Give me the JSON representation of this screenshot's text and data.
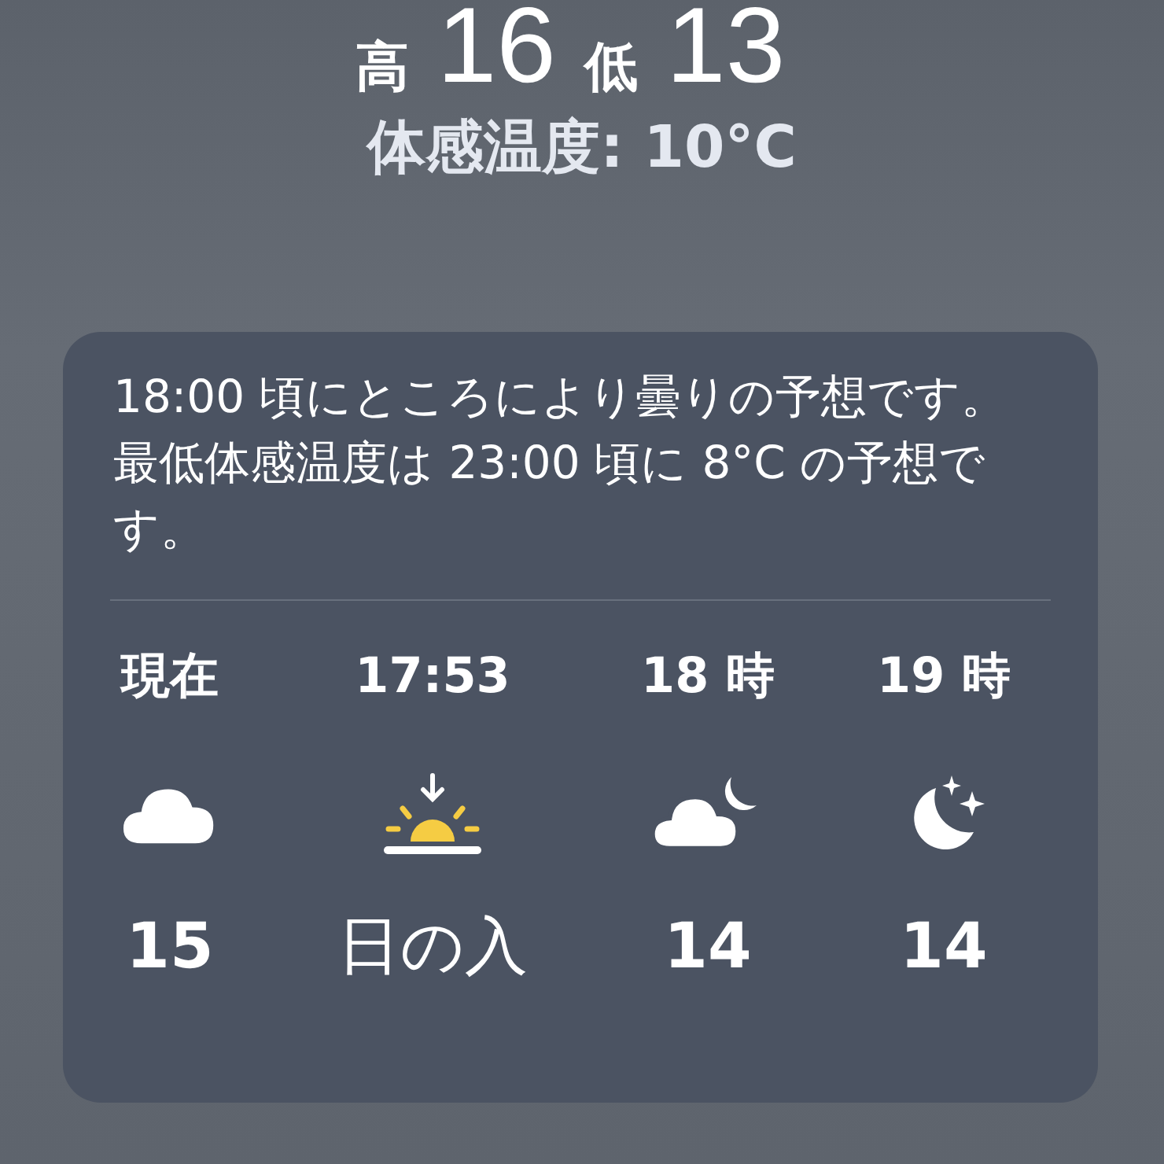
{
  "high": {
    "label": "高",
    "value": "16"
  },
  "low": {
    "label": "低",
    "value": "13"
  },
  "feels_like": "体感温度: 10°C",
  "summary": "18:00 頃にところにより曇りの予想です。最低体感温度は 23:00 頃に 8°C の予想です。",
  "hourly": [
    {
      "time": "現在",
      "kind": "cloudy",
      "temp": "15"
    },
    {
      "time": "17:53",
      "kind": "sunset",
      "temp": "日の入"
    },
    {
      "time": "18 時",
      "kind": "partly-cloudy-night",
      "temp": "14"
    },
    {
      "time": "19 時",
      "kind": "clear-night",
      "temp": "14"
    }
  ]
}
